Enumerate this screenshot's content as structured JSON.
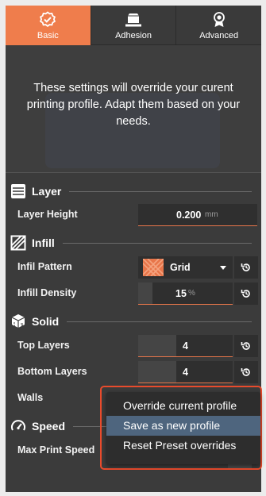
{
  "tabs": [
    {
      "label": "Basic",
      "icon": "badge-check-icon",
      "active": true
    },
    {
      "label": "Adhesion",
      "icon": "cube-platform-icon",
      "active": false
    },
    {
      "label": "Advanced",
      "icon": "award-ribbon-icon",
      "active": false
    }
  ],
  "banner": {
    "message": "These settings will override your curent printing profile. Adapt them based on your needs."
  },
  "sections": {
    "layer": {
      "title": "Layer",
      "icon": "layers-icon"
    },
    "infill": {
      "title": "Infill",
      "icon": "hatched-square-icon"
    },
    "solid": {
      "title": "Solid",
      "icon": "solid-cube-icon"
    },
    "speed": {
      "title": "Speed",
      "icon": "speedometer-icon"
    }
  },
  "settings": {
    "layer_height": {
      "label": "Layer Height",
      "value": "0.200",
      "unit": "mm",
      "fill": 0.0
    },
    "infill_pattern": {
      "label": "Infil Pattern",
      "value": "Grid",
      "pattern_icon": "grid-pattern-icon"
    },
    "infill_density": {
      "label": "Infill Density",
      "value": "15",
      "unit": "%",
      "fill": 0.15
    },
    "top_layers": {
      "label": "Top Layers",
      "value": "4",
      "fill": 0.4
    },
    "bottom_layers": {
      "label": "Bottom Layers",
      "value": "4",
      "fill": 0.4
    },
    "walls": {
      "label": "Walls"
    },
    "max_print_speed": {
      "label": "Max Print Speed"
    }
  },
  "context_menu": {
    "items": [
      {
        "label": "Override current profile",
        "highlighted": false
      },
      {
        "label": "Save as new profile",
        "highlighted": true
      },
      {
        "label": "Reset Preset overrides",
        "highlighted": false
      }
    ]
  },
  "colors": {
    "accent": "#ef7d4c",
    "panel": "#3b3b3b",
    "highlight": "#4e657e",
    "annotation_outline": "#e94b2c"
  }
}
